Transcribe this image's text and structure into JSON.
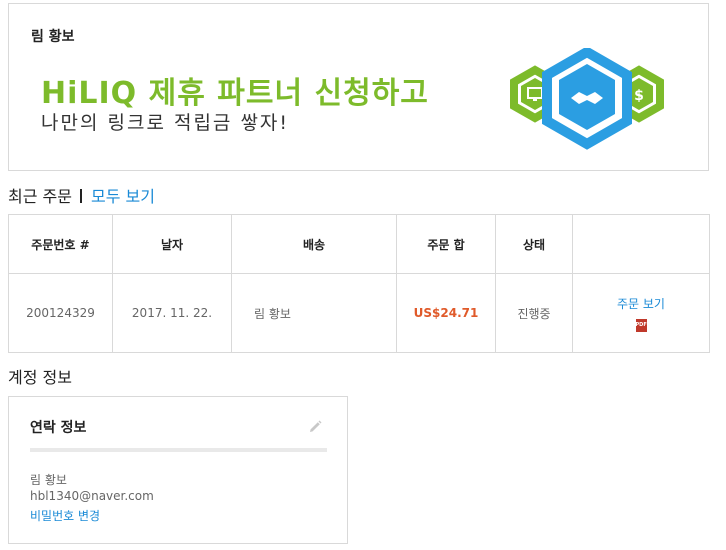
{
  "banner": {
    "user_name": "림 황보",
    "promo_title": "HiLIQ 제휴 파트너 신청하고",
    "promo_subtitle": "나만의 링크로 적립금 쌓자!",
    "icons": [
      "monitor-icon",
      "handshake-icon",
      "dollar-icon"
    ],
    "colors": {
      "green": "#7dbb2b",
      "blue": "#2b9ee2"
    }
  },
  "recent_orders": {
    "title": "최근 주문",
    "view_all_label": "모두 보기",
    "columns": [
      "주문번호 #",
      "날자",
      "배송",
      "주문 합",
      "상태",
      ""
    ],
    "rows": [
      {
        "order_no": "200124329",
        "date": "2017. 11. 22.",
        "ship_to": "림 황보",
        "total": "US$24.71",
        "status": "진행중",
        "action_label": "주문 보기",
        "pdf_label": "PDF"
      }
    ]
  },
  "account": {
    "title": "계정 정보",
    "contact": {
      "title": "연락 정보",
      "name": "림 황보",
      "email": "hbl1340@naver.com",
      "change_password_label": "비밀번호 변경"
    }
  },
  "colors": {
    "link": "#1a8ad6",
    "price": "#e05a2a",
    "border": "#d9d9d9"
  }
}
